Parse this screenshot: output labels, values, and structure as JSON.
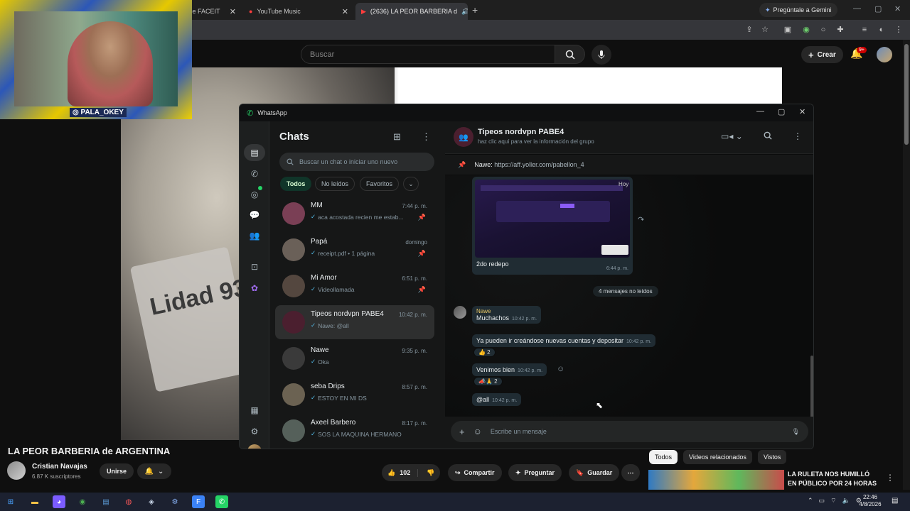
{
  "browser": {
    "tabs": [
      {
        "label": "a de FACEIT"
      },
      {
        "label": "YouTube Music"
      },
      {
        "label": "(2636) LA PEOR BARBERIA d"
      }
    ],
    "gemini": "Pregúntale a Gemini"
  },
  "youtube": {
    "search_placeholder": "Buscar",
    "create": "Crear",
    "notif_count": "9+",
    "video_title": "LA PEOR BARBERIA de ARGENTINA",
    "channel": "Cristian Navajas",
    "subscribers": "6.87 K suscriptores",
    "join": "Unirse",
    "likes": "102",
    "share": "Compartir",
    "ask": "Preguntar",
    "save": "Guardar",
    "chips": [
      "Todos",
      "Videos relacionados",
      "Vistos"
    ],
    "rec_title": "LA RULETA NOS HUMILLÓ EN PÚBLICO POR 24 HORAS",
    "video_text": "Lidad 93",
    "webcam_tag": "PALA_OKEY"
  },
  "whatsapp": {
    "title": "WhatsApp",
    "chats_title": "Chats",
    "search_placeholder": "Buscar un chat o iniciar uno nuevo",
    "filters": [
      "Todos",
      "No leídos",
      "Favoritos"
    ],
    "chats": [
      {
        "name": "MM",
        "time": "7:44 p. m.",
        "preview": "aca acostada recien me estab...",
        "pinned": true,
        "color": "#7a3f55"
      },
      {
        "name": "Papá",
        "time": "domingo",
        "preview": "receipt.pdf • 1 página",
        "pinned": true,
        "color": "#6a6058"
      },
      {
        "name": "Mi Amor",
        "time": "6:51 p. m.",
        "preview": "Videollamada",
        "pinned": true,
        "color": "#54473f"
      },
      {
        "name": "Tipeos nordvpn PABE4",
        "time": "10:42 p. m.",
        "preview": "Nawe: @all",
        "pinned": false,
        "color": "#4b1f2f"
      },
      {
        "name": "Nawe",
        "time": "9:35 p. m.",
        "preview": "Oka",
        "pinned": false,
        "color": "#3a3a3a"
      },
      {
        "name": "seba Drips",
        "time": "8:57 p. m.",
        "preview": "ESTOY EN MI DS",
        "pinned": false,
        "color": "#6b6252"
      },
      {
        "name": "Axeel Barbero",
        "time": "8:17 p. m.",
        "preview": "SOS LA MAQUINA HERMANO",
        "pinned": false,
        "color": "#55605a"
      }
    ],
    "conversation": {
      "group_name": "Tipeos nordvpn PABE4",
      "group_sub": "haz clic aquí para ver la información del grupo",
      "pinned_author": "Nawe:",
      "pinned_text": "https://aff.yoller.com/pabellon_4",
      "image_badge": "Hoy",
      "image_caption": "2do redepo",
      "image_time": "6:44 p. m.",
      "unread_label": "4 mensajes no leídos",
      "sender": "Nawe",
      "messages": [
        {
          "text": "Muchachos",
          "time": "10:42 p. m.",
          "reaction": ""
        },
        {
          "text": "Ya pueden ir creándose nuevas cuentas y depositar",
          "time": "10:42 p. m.",
          "reaction": "👍 2"
        },
        {
          "text": "Venimos bien",
          "time": "10:42 p. m.",
          "reaction": "📣🙏 2"
        },
        {
          "text": "@all",
          "time": "10:42 p. m.",
          "reaction": ""
        }
      ],
      "input_placeholder": "Escribe un mensaje"
    }
  },
  "taskbar": {
    "time": "22:46",
    "date": "4/8/2026"
  }
}
